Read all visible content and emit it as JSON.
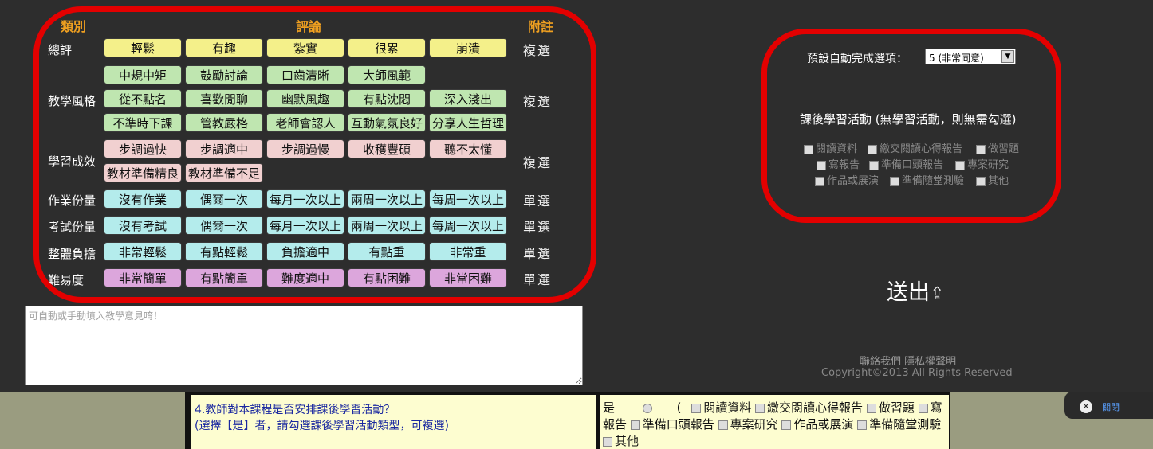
{
  "headers": {
    "category": "類別",
    "review": "評論",
    "note": "附註"
  },
  "rows": [
    {
      "label": "總評",
      "mode": "複選",
      "tags": [
        [
          "輕鬆",
          "有趣",
          "紮實",
          "很累",
          "崩潰"
        ]
      ]
    },
    {
      "label": "教學風格",
      "mode": "複選",
      "tags": [
        [
          "中規中矩",
          "鼓勵討論",
          "口齒清晰",
          "大師風範"
        ],
        [
          "從不點名",
          "喜歡閒聊",
          "幽默風趣",
          "有點沈悶",
          "深入淺出"
        ],
        [
          "不準時下課",
          "管教嚴格",
          "老師會認人",
          "互動氣氛良好",
          "分享人生哲理"
        ]
      ]
    },
    {
      "label": "學習成效",
      "mode": "複選",
      "tags": [
        [
          "步調過快",
          "步調適中",
          "步調過慢",
          "收穫豐碩",
          "聽不太懂"
        ],
        [
          "教材準備精良",
          "教材準備不足"
        ]
      ]
    },
    {
      "label": "作業份量",
      "mode": "單選",
      "tags": [
        [
          "沒有作業",
          "偶爾一次",
          "每月一次以上",
          "兩周一次以上",
          "每周一次以上"
        ]
      ]
    },
    {
      "label": "考試份量",
      "mode": "單選",
      "tags": [
        [
          "沒有考試",
          "偶爾一次",
          "每月一次以上",
          "兩周一次以上",
          "每周一次以上"
        ]
      ]
    },
    {
      "label": "整體負擔",
      "mode": "單選",
      "tags": [
        [
          "非常輕鬆",
          "有點輕鬆",
          "負擔適中",
          "有點重",
          "非常重"
        ]
      ]
    },
    {
      "label": "難易度",
      "mode": "單選",
      "tags": [
        [
          "非常簡單",
          "有點簡單",
          "難度適中",
          "有點困難",
          "非常困難"
        ]
      ]
    }
  ],
  "comment_placeholder": "可自動或手動填入教學意見唷！",
  "right": {
    "default_label": "預設自動完成選項：",
    "default_value": "5 (非常同意)",
    "activity_title": "課後學習活動 (無學習活動，則無需勾選)",
    "activities": [
      "閱讀資料",
      "繳交閱讀心得報告",
      "做習題",
      "寫報告",
      "準備口頭報告",
      "專案研究",
      "作品或展演",
      "準備隨堂測驗",
      "其他"
    ],
    "submit": "送出",
    "footer_links": "聯絡我們 隱私權聲明",
    "copyright": "Copyright©2013 All Rights Reserved"
  },
  "bottom": {
    "question_line1": "4.教師對本課程是否安排課後學習活動？",
    "question_line2": "(選擇【是】者，請勾選課後學習活動類型，可複選)",
    "yes": "是",
    "paren": "(",
    "acts": [
      "閱讀資料",
      "繳交閱讀心得報告",
      "做習題",
      "寫報告",
      "準備口頭報告",
      "專案研究",
      "作品或展演",
      "準備隨堂測驗",
      "其他"
    ],
    "close": "關閉"
  }
}
